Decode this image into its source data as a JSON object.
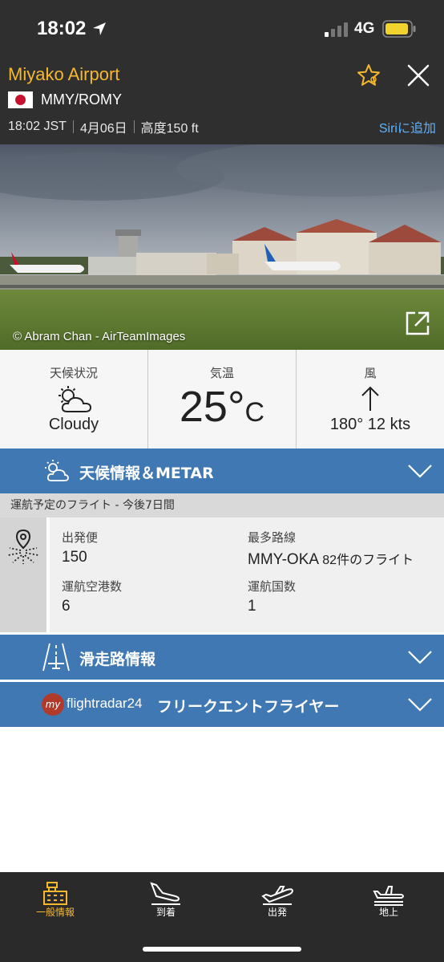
{
  "status_bar": {
    "time": "18:02",
    "network": "4G"
  },
  "header": {
    "airport_name": "Miyako Airport",
    "codes": "MMY/ROMY",
    "local_time": "18:02 JST",
    "date": "4月06日",
    "elevation": "高度150 ft",
    "siri_label": "Siriに追加"
  },
  "photo": {
    "credit": "© Abram Chan - AirTeamImages"
  },
  "weather": {
    "condition_label": "天候状況",
    "condition": "Cloudy",
    "temp_label": "気温",
    "temp_value": "25°",
    "temp_unit": "C",
    "wind_label": "風",
    "wind_value": "180° 12 kts"
  },
  "sections": {
    "weather_metar": "天候情報＆METAR",
    "runway": "滑走路情報",
    "frequent_flyer": "フリークエントフライヤー",
    "fr_logo_my": "my",
    "fr_logo_text": "flightradar24"
  },
  "upcoming": {
    "header": "運航予定のフライト - 今後7日間",
    "departures_label": "出発便",
    "departures_value": "150",
    "top_route_label": "最多路線",
    "top_route_value": "MMY-OKA",
    "top_route_count": "82件のフライト",
    "airports_label": "運航空港数",
    "airports_value": "6",
    "countries_label": "運航国数",
    "countries_value": "1"
  },
  "tabs": [
    {
      "label": "一般情報",
      "active": true
    },
    {
      "label": "到着"
    },
    {
      "label": "出発"
    },
    {
      "label": "地上"
    }
  ],
  "colors": {
    "accent": "#f5b82e",
    "header_bg": "#2f2f2f",
    "section_bar": "#3f78b3",
    "link": "#5fb0ff"
  }
}
